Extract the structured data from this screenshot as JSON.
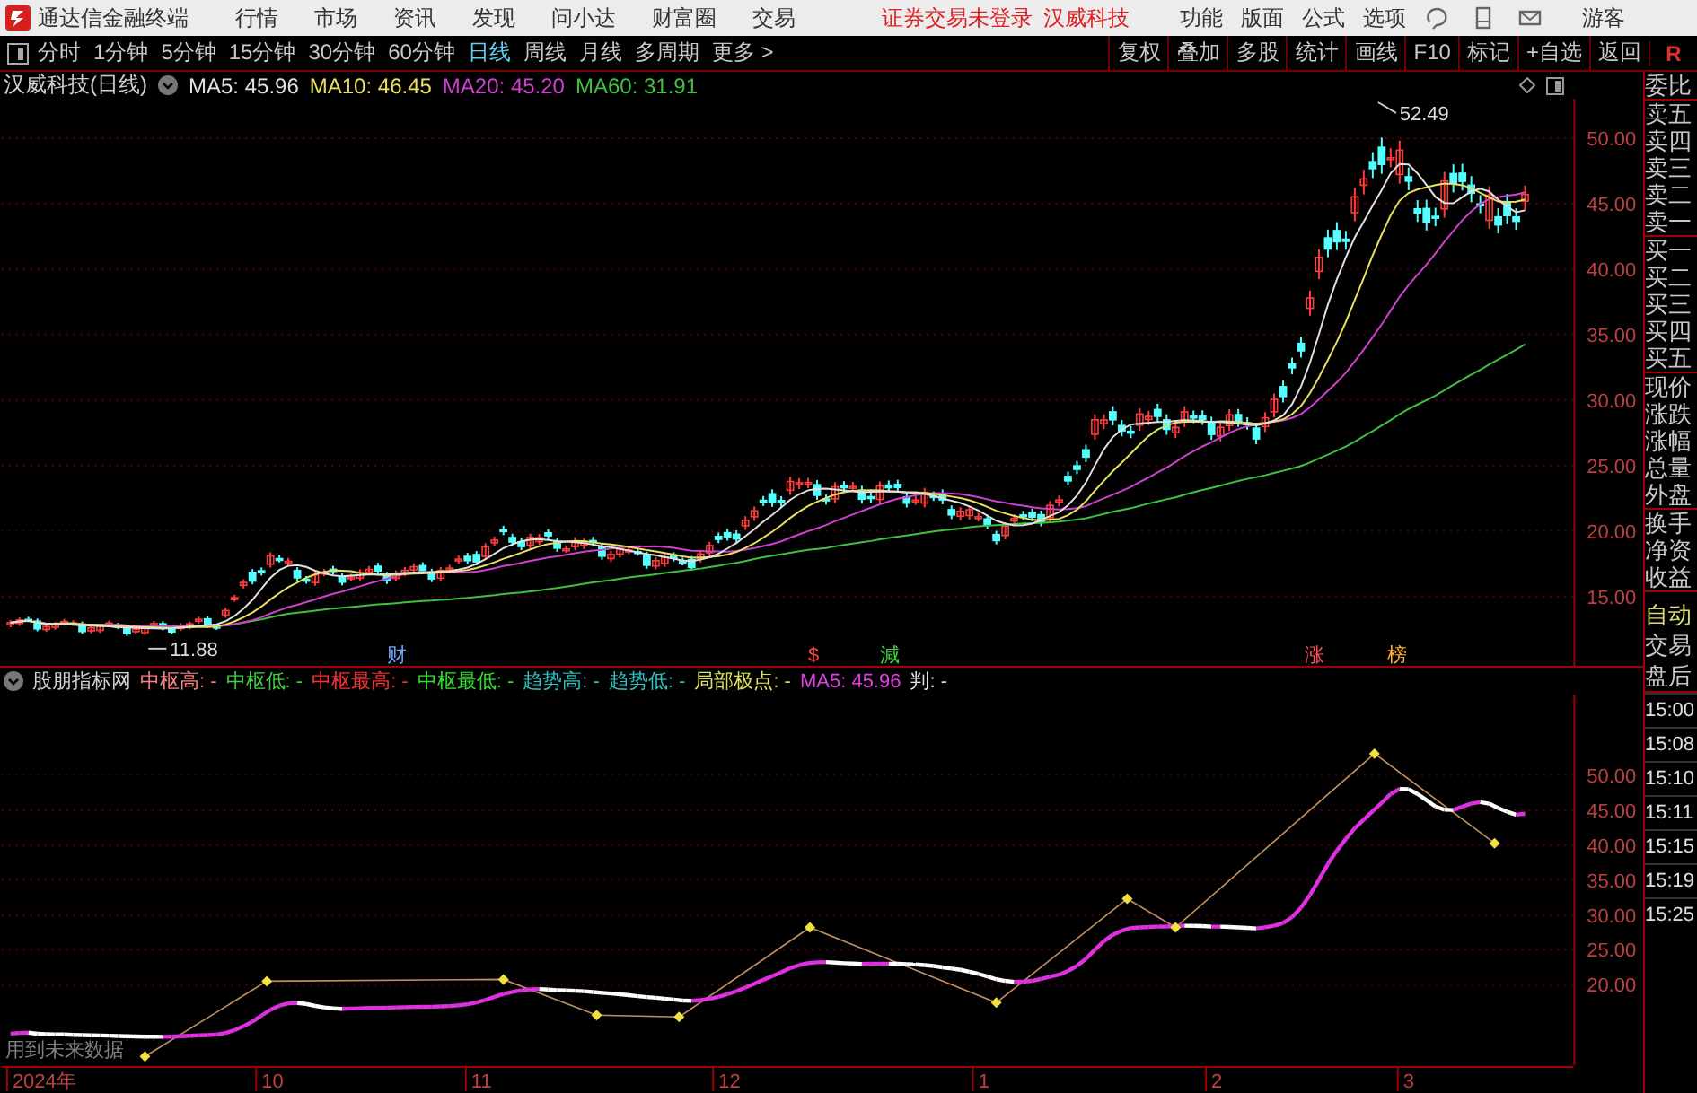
{
  "menu_bar": {
    "app_title": "通达信金融终端",
    "menus": [
      "行情",
      "市场",
      "资讯",
      "发现",
      "问小达",
      "财富圈",
      "交易"
    ],
    "notice": "证券交易未登录",
    "stock_name": "汉威科技",
    "tools": [
      "功能",
      "版面",
      "公式",
      "选项"
    ],
    "user": "游客"
  },
  "toolbar": {
    "periods": [
      {
        "label": "分时",
        "selected": false
      },
      {
        "label": "1分钟",
        "selected": false
      },
      {
        "label": "5分钟",
        "selected": false
      },
      {
        "label": "15分钟",
        "selected": false
      },
      {
        "label": "30分钟",
        "selected": false
      },
      {
        "label": "60分钟",
        "selected": false
      },
      {
        "label": "日线",
        "selected": true
      },
      {
        "label": "周线",
        "selected": false
      },
      {
        "label": "月线",
        "selected": false
      },
      {
        "label": "多周期",
        "selected": false
      }
    ],
    "more": "更多 >",
    "actions": [
      "复权",
      "叠加",
      "多股",
      "统计",
      "画线",
      "F10",
      "标记",
      "+自选",
      "返回"
    ],
    "right_mark": "R"
  },
  "price_panel": {
    "title": "汉威科技(日线)",
    "legend": [
      {
        "label": "MA5: 45.96",
        "color": "#e0e0e0"
      },
      {
        "label": "MA10: 46.45",
        "color": "#e8e060"
      },
      {
        "label": "MA20: 45.20",
        "color": "#d040d0"
      },
      {
        "label": "MA60: 31.91",
        "color": "#40c040"
      }
    ],
    "y_ticks": [
      "50.00",
      "45.00",
      "40.00",
      "35.00",
      "30.00",
      "25.00",
      "20.00",
      "15.00"
    ],
    "high_label": "52.49",
    "low_label": "11.88",
    "events": [
      {
        "label": "财",
        "color": "#6aa8ff"
      },
      {
        "label": "$",
        "color": "#ff4040"
      },
      {
        "label": "減",
        "color": "#40d040"
      },
      {
        "label": "涨",
        "color": "#ff5050"
      },
      {
        "label": "榜",
        "color": "#ffb030"
      }
    ]
  },
  "indicator_panel": {
    "name": "股朋指标网",
    "legend": [
      {
        "label": "中枢高: -",
        "color": "#ff8080"
      },
      {
        "label": "中枢低: -",
        "color": "#40d040"
      },
      {
        "label": "中枢最高: -",
        "color": "#ff3030"
      },
      {
        "label": "中枢最低: -",
        "color": "#30e030"
      },
      {
        "label": "趋势高: -",
        "color": "#30c0c0"
      },
      {
        "label": "趋势低: -",
        "color": "#30c0c0"
      },
      {
        "label": "局部极点: -",
        "color": "#e0e060"
      },
      {
        "label": "MA5: 45.96",
        "color": "#e040e0"
      },
      {
        "label": "判: -",
        "color": "#e0e0e0"
      }
    ],
    "y_ticks": [
      "50.00",
      "45.00",
      "40.00",
      "35.00",
      "30.00",
      "25.00",
      "20.00"
    ],
    "note": "用到未来数据"
  },
  "x_axis": [
    "2024年",
    "10",
    "11",
    "12",
    "1",
    "2",
    "3"
  ],
  "side_panel": {
    "quote_labels": [
      "委比",
      "卖五",
      "卖四",
      "卖三",
      "卖二",
      "卖一",
      "买一",
      "买二",
      "买三",
      "买四",
      "买五",
      "现价",
      "涨跌",
      "涨幅",
      "总量",
      "外盘",
      "换手",
      "净资",
      "收益"
    ],
    "header": "自动",
    "items": [
      "交易",
      "盘后"
    ],
    "times": [
      "15:00",
      "15:08",
      "15:10",
      "15:11",
      "15:15",
      "15:19",
      "15:25"
    ]
  }
}
